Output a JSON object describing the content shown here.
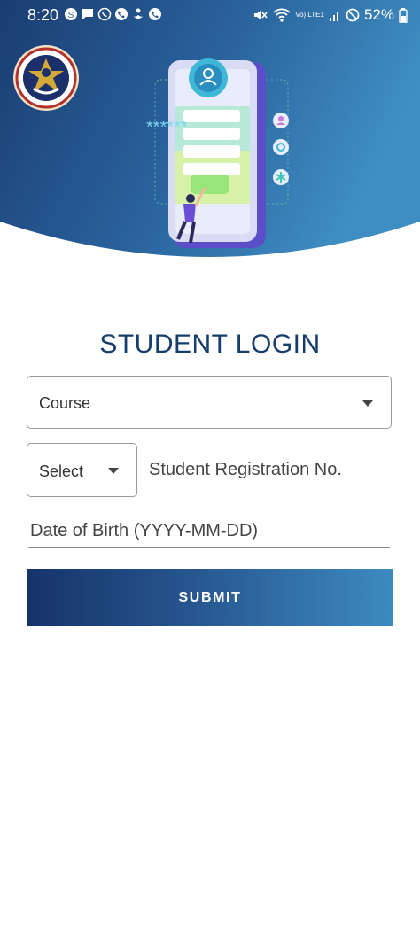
{
  "status_bar": {
    "time": "8:20",
    "network_label": "Vo) LTE1",
    "battery": "52%"
  },
  "header": {
    "logo_icon": "institute-emblem-icon",
    "illustration": "login-illustration",
    "password_mask": "******"
  },
  "form": {
    "title": "STUDENT LOGIN",
    "course_label": "Course",
    "select_label": "Select",
    "registration_placeholder": "Student Registration No.",
    "dob_placeholder": "Date of Birth (YYYY-MM-DD)",
    "submit_label": "SUBMIT"
  },
  "colors": {
    "title": "#163d6e",
    "header_dark": "#1b3f73",
    "header_light": "#3f8ec3",
    "button_start": "#16336a",
    "button_end": "#3d8bc0"
  }
}
